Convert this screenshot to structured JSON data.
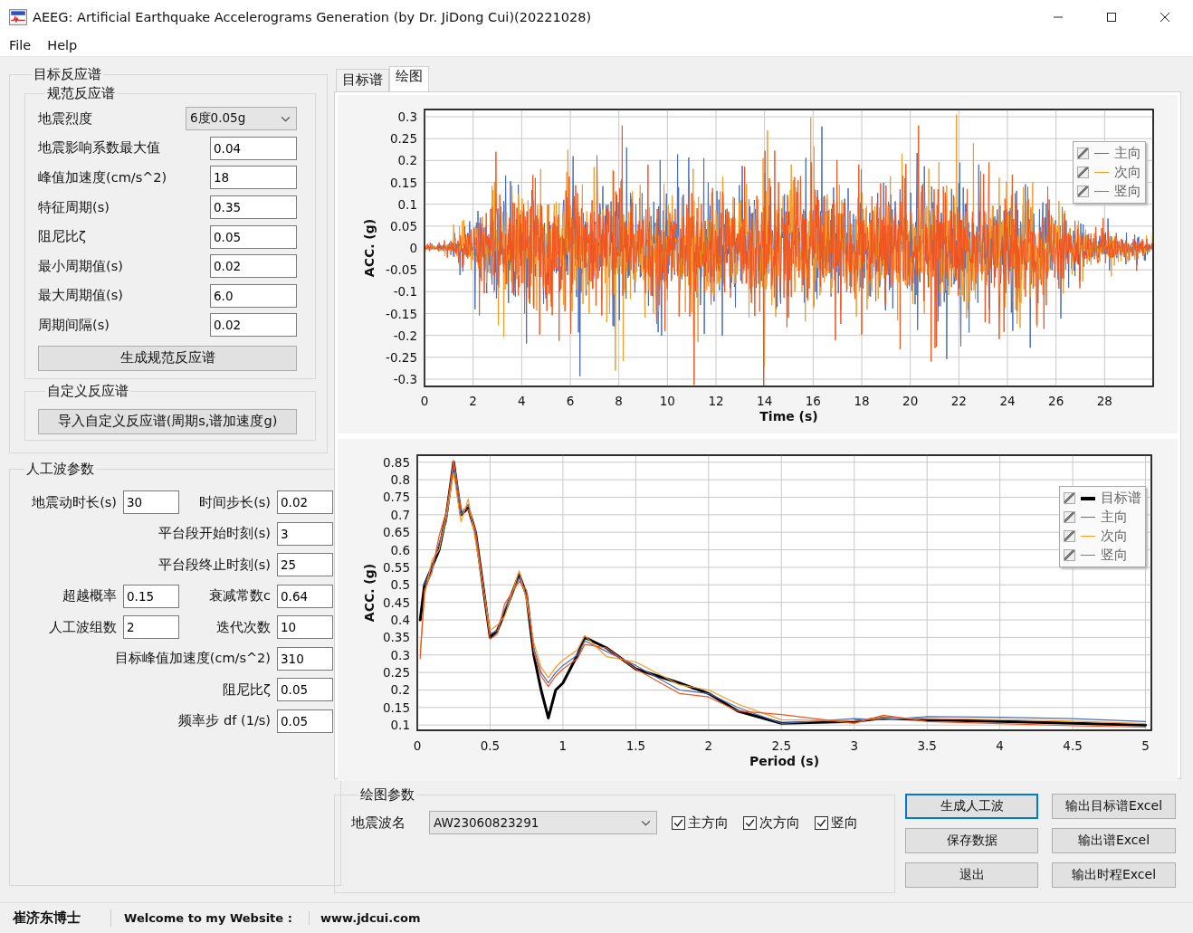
{
  "window": {
    "title": "AEEG: Artificial Earthquake Accelerograms Generation (by Dr. JiDong Cui)(20221028)"
  },
  "menu": [
    "File",
    "Help"
  ],
  "target_spectrum": {
    "title": "目标反应谱",
    "code_spectrum": {
      "title": "规范反应谱",
      "intensity": {
        "label": "地震烈度",
        "value": "6度0.05g"
      },
      "fields": [
        {
          "label": "地震影响系数最大值",
          "value": "0.04"
        },
        {
          "label": "峰值加速度(cm/s^2)",
          "value": "18"
        },
        {
          "label": "特征周期(s)",
          "value": "0.35"
        },
        {
          "label": "阻尼比ζ",
          "value": "0.05"
        },
        {
          "label": "最小周期值(s)",
          "value": "0.02"
        },
        {
          "label": "最大周期值(s)",
          "value": "6.0"
        },
        {
          "label": "周期间隔(s)",
          "value": "0.02"
        }
      ],
      "button": "生成规范反应谱"
    },
    "custom_spectrum": {
      "title": "自定义反应谱",
      "button": "导入自定义反应谱(周期s,谱加速度g)"
    }
  },
  "wave_params": {
    "title": "人工波参数",
    "rows": [
      {
        "left": {
          "label": "地震动时长(s)",
          "value": "30"
        },
        "right": {
          "label": "时间步长(s)",
          "value": "0.02"
        }
      },
      {
        "right": {
          "label": "平台段开始时刻(s)",
          "value": "3"
        }
      },
      {
        "right": {
          "label": "平台段终止时刻(s)",
          "value": "25"
        }
      },
      {
        "left": {
          "label": "超越概率",
          "value": "0.15"
        },
        "right": {
          "label": "衰减常数c",
          "value": "0.64"
        }
      },
      {
        "left": {
          "label": "人工波组数",
          "value": "2"
        },
        "right": {
          "label": "迭代次数",
          "value": "10"
        }
      },
      {
        "right": {
          "label": "目标峰值加速度(cm/s^2)",
          "value": "310"
        }
      },
      {
        "right": {
          "label": "阻尼比ζ",
          "value": "0.05"
        }
      },
      {
        "right": {
          "label": "频率步 df (1/s)",
          "value": "0.05"
        }
      }
    ]
  },
  "tabs": [
    {
      "label": "目标谱",
      "selected": false
    },
    {
      "label": "绘图",
      "selected": true
    }
  ],
  "time_history": {
    "ylabel": "ACC. (g)",
    "xlabel": "Time (s)",
    "yticks": [
      "0.3",
      "0.25",
      "0.2",
      "0.15",
      "0.1",
      "0.05",
      "0",
      "-0.05",
      "-0.1",
      "-0.15",
      "-0.2",
      "-0.25",
      "-0.3"
    ],
    "xticks": [
      "0",
      "2",
      "4",
      "6",
      "8",
      "10",
      "12",
      "14",
      "16",
      "18",
      "20",
      "22",
      "24",
      "26",
      "28"
    ],
    "legend": [
      {
        "label": "主向",
        "color": "#4a6db8",
        "checked": true
      },
      {
        "label": "次向",
        "color": "#f59b25",
        "checked": true
      },
      {
        "label": "竖向",
        "color": "#f2541e",
        "checked": true
      }
    ]
  },
  "spectrum": {
    "legend_checks": [
      {
        "checked": true
      },
      {
        "checked": true
      },
      {
        "checked": true
      },
      {
        "checked": true
      }
    ],
    "chart_data": {
      "type": "line",
      "xlabel": "Period (s)",
      "ylabel": "ACC. (g)",
      "grid": true,
      "legend": "upper right",
      "x": [
        0.02,
        0.05,
        0.1,
        0.15,
        0.2,
        0.25,
        0.3,
        0.35,
        0.4,
        0.5,
        0.55,
        0.6,
        0.7,
        0.75,
        0.8,
        0.85,
        0.9,
        0.95,
        1.0,
        1.1,
        1.15,
        1.3,
        1.5,
        1.8,
        2.0,
        2.2,
        2.5,
        3.0,
        3.2,
        3.5,
        4.0,
        4.5,
        5.0
      ],
      "series": [
        {
          "name": "目标谱",
          "color": "#000000",
          "values": [
            0.4,
            0.5,
            0.55,
            0.6,
            0.7,
            0.85,
            0.7,
            0.72,
            0.65,
            0.35,
            0.37,
            0.42,
            0.53,
            0.47,
            0.3,
            0.2,
            0.12,
            0.2,
            0.22,
            0.3,
            0.35,
            0.32,
            0.26,
            0.22,
            0.19,
            0.14,
            0.105,
            0.11,
            0.12,
            0.115,
            0.11,
            0.105,
            0.1
          ]
        },
        {
          "name": "主向",
          "color": "#4a6db8",
          "values": [
            null,
            0.5,
            0.55,
            0.62,
            0.68,
            0.84,
            0.7,
            0.73,
            0.64,
            0.36,
            0.37,
            0.43,
            0.52,
            0.47,
            0.32,
            0.25,
            0.22,
            0.25,
            0.27,
            0.3,
            0.34,
            0.31,
            0.27,
            0.2,
            0.19,
            0.15,
            0.105,
            0.118,
            0.115,
            0.124,
            0.122,
            0.118,
            0.11
          ]
        },
        {
          "name": "次向",
          "color": "#f59b25",
          "values": [
            0.31,
            0.47,
            0.57,
            0.6,
            0.7,
            0.82,
            0.68,
            0.745,
            0.625,
            0.37,
            0.385,
            0.41,
            0.54,
            0.455,
            0.335,
            0.265,
            0.235,
            0.265,
            0.285,
            0.315,
            0.355,
            0.295,
            0.28,
            0.215,
            0.2,
            0.16,
            0.115,
            0.112,
            0.121,
            0.118,
            0.116,
            0.111,
            0.104
          ]
        },
        {
          "name": "竖向",
          "color": "#f2541e",
          "values": [
            0.29,
            0.485,
            0.535,
            0.64,
            0.71,
            0.855,
            0.715,
            0.715,
            0.655,
            0.345,
            0.36,
            0.445,
            0.51,
            0.485,
            0.31,
            0.24,
            0.21,
            0.24,
            0.26,
            0.29,
            0.33,
            0.32,
            0.26,
            0.19,
            0.18,
            0.14,
            0.13,
            0.105,
            0.128,
            0.11,
            0.104,
            0.098,
            0.094
          ]
        }
      ],
      "xlim": [
        0,
        5.04
      ],
      "ylim": [
        0.085,
        0.87
      ],
      "xticks": [
        0,
        {
          "value": 0.5,
          "label": "0.5"
        },
        1,
        {
          "value": 1.5,
          "label": "1.5"
        },
        2,
        {
          "value": 2.5,
          "label": "2.5"
        },
        3,
        {
          "value": 3.5,
          "label": "3.5"
        },
        4,
        {
          "value": 4.5,
          "label": "4.5"
        },
        5
      ],
      "yticks": [
        0.1,
        0.15,
        0.2,
        0.25,
        0.3,
        0.35,
        0.4,
        0.45,
        0.5,
        0.55,
        0.6,
        0.65,
        0.7,
        0.75,
        0.8,
        0.85
      ]
    }
  },
  "plot_params": {
    "title": "绘图参数",
    "wave_label": "地震波名",
    "wave_value": "AW23060823291",
    "checks": [
      {
        "label": "主方向",
        "checked": true
      },
      {
        "label": "次方向",
        "checked": true
      },
      {
        "label": "竖向",
        "checked": true
      }
    ]
  },
  "buttons": [
    {
      "label": "生成人工波",
      "default": true
    },
    {
      "label": "输出目标谱Excel",
      "default": false
    },
    {
      "label": "保存数据",
      "default": false
    },
    {
      "label": "输出谱Excel",
      "default": false
    },
    {
      "label": "退出",
      "default": false
    },
    {
      "label": "输出时程Excel",
      "default": false
    }
  ],
  "status_bar": [
    "崔济东博士",
    "Welcome to my Website :",
    "www.jdcui.com"
  ]
}
